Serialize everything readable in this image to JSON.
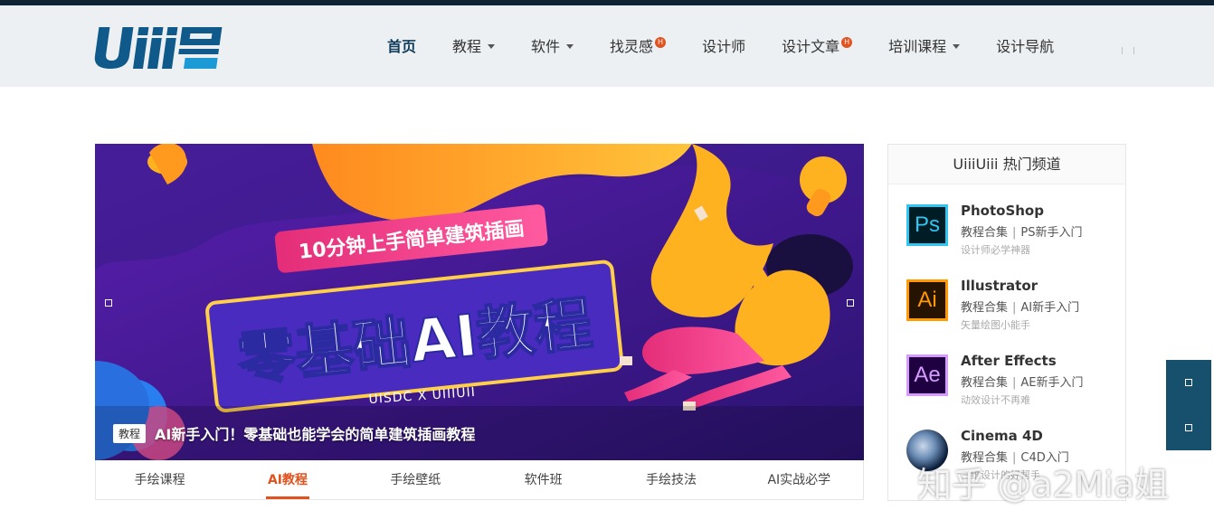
{
  "header": {
    "logo_text": "Uiii☷",
    "nav": [
      {
        "label": "首页",
        "active": true,
        "dropdown": false,
        "hot": false
      },
      {
        "label": "教程",
        "active": false,
        "dropdown": true,
        "hot": false
      },
      {
        "label": "软件",
        "active": false,
        "dropdown": true,
        "hot": false
      },
      {
        "label": "找灵感",
        "active": false,
        "dropdown": false,
        "hot": true
      },
      {
        "label": "设计师",
        "active": false,
        "dropdown": false,
        "hot": false
      },
      {
        "label": "设计文章",
        "active": false,
        "dropdown": false,
        "hot": true
      },
      {
        "label": "培训课程",
        "active": false,
        "dropdown": true,
        "hot": false
      },
      {
        "label": "设计导航",
        "active": false,
        "dropdown": false,
        "hot": false
      }
    ],
    "hot_badge": "H"
  },
  "slider": {
    "banner_subtitle": "10分钟上手简单建筑插画",
    "banner_title": "零基础AI教程",
    "banner_credit": "UISDC X UIIIUII",
    "caption_tag": "教程",
    "caption_text": "AI新手入门！零基础也能学会的简单建筑插画教程"
  },
  "tabs": [
    {
      "label": "手绘课程",
      "active": false
    },
    {
      "label": "AI教程",
      "active": true
    },
    {
      "label": "手绘壁纸",
      "active": false
    },
    {
      "label": "软件班",
      "active": false
    },
    {
      "label": "手绘技法",
      "active": false
    },
    {
      "label": "AI实战必学",
      "active": false
    }
  ],
  "panel": {
    "title": "UiiiUiii 热门频道",
    "channels": [
      {
        "icon": "Ps",
        "name": "PhotoShop",
        "link1": "教程合集",
        "link2": "PS新手入门",
        "desc": "设计师必学神器",
        "icon_bg": "#001d26",
        "icon_fg": "#31c5f0"
      },
      {
        "icon": "Ai",
        "name": "Illustrator",
        "link1": "教程合集",
        "link2": "AI新手入门",
        "desc": "矢量绘图小能手",
        "icon_bg": "#261300",
        "icon_fg": "#ff9a00"
      },
      {
        "icon": "Ae",
        "name": "After Effects",
        "link1": "教程合集",
        "link2": "AE新手入门",
        "desc": "动效设计不再难",
        "icon_bg": "#1f0040",
        "icon_fg": "#d69bff"
      },
      {
        "icon": "C4D",
        "name": "Cinema 4D",
        "link1": "教程合集",
        "link2": "C4D入门",
        "desc": "三维设计的好帮手",
        "icon_bg": "#0b1e3a",
        "icon_fg": "#9fc5ee"
      }
    ]
  },
  "watermark": "知乎 @a2Mia姐"
}
